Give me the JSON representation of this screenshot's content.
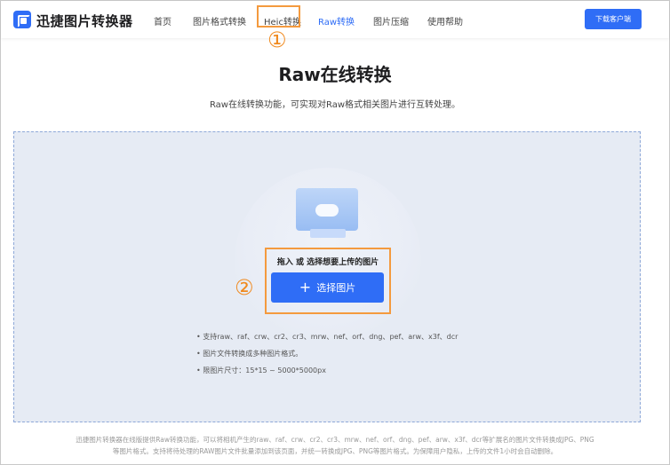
{
  "header": {
    "brand": "迅捷图片转换器",
    "nav": [
      "首页",
      "图片格式转换",
      "Heic转换",
      "Raw转换",
      "图片压缩",
      "使用帮助"
    ],
    "download_label": "下载客户端"
  },
  "annotations": {
    "step1": "①",
    "step2": "②"
  },
  "page": {
    "title": "Raw在线转换",
    "subtitle": "Raw在线转换功能，可实现对Raw格式相关图片进行互转处理。"
  },
  "upload": {
    "drag_text": "拖入 或 选择想要上传的图片",
    "button_label": "选择图片",
    "plus": "+",
    "notes": [
      "• 支持raw、raf、crw、cr2、cr3、mrw、nef、orf、dng、pef、arw、x3f、dcr",
      "• 图片文件转换成多种图片格式。",
      "• 限图片尺寸：15*15 ~ 5000*5000px"
    ]
  },
  "footer": {
    "line1": "迅捷图片转换器在线版提供Raw转换功能，可以将相机产生的raw、raf、crw、cr2、cr3、mrw、nef、orf、dng、pef、arw、x3f、dcr等扩展名的图片文件转换成JPG、PNG",
    "line2": "等图片格式。支持将待处理的RAW图片文件批量添加到该页面，并统一转换成JPG、PNG等图片格式。为保障用户隐私，上传的文件1小时会自动删除。"
  },
  "colors": {
    "accent": "#2f6df6",
    "highlight": "#f49a3e"
  }
}
